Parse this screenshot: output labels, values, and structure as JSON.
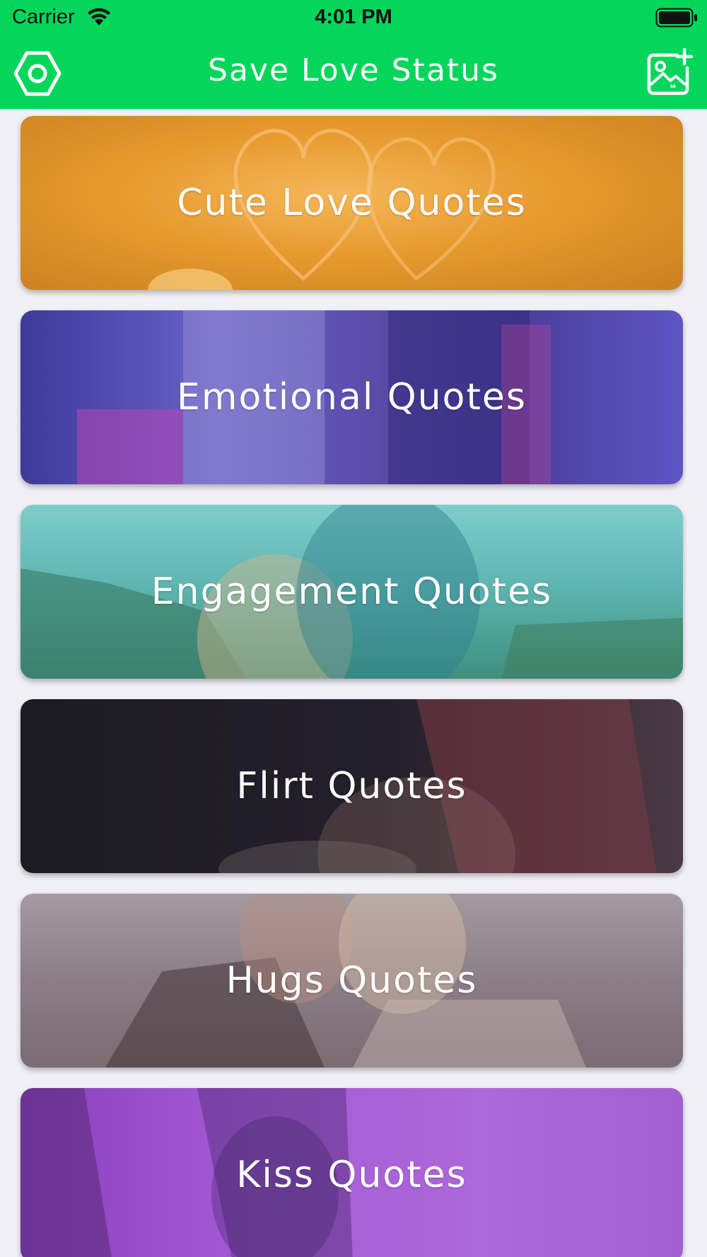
{
  "status_bar": {
    "carrier": "Carrier",
    "time": "4:01 PM"
  },
  "navbar": {
    "title": "Save Love Status",
    "settings_icon": "settings-hexagon-icon",
    "add_icon": "add-image-quote-icon",
    "color": "#03d65a"
  },
  "categories": [
    {
      "label": "Cute Love Quotes",
      "tint": "#e59a27"
    },
    {
      "label": "Emotional Quotes",
      "tint": "#4f45c2"
    },
    {
      "label": "Engagement Quotes",
      "tint": "#3aa7a0"
    },
    {
      "label": "Flirt Quotes",
      "tint": "#1d1a26"
    },
    {
      "label": "Hugs Quotes",
      "tint": "#8a7f86"
    },
    {
      "label": "Kiss Quotes",
      "tint": "#9a48d0"
    }
  ]
}
